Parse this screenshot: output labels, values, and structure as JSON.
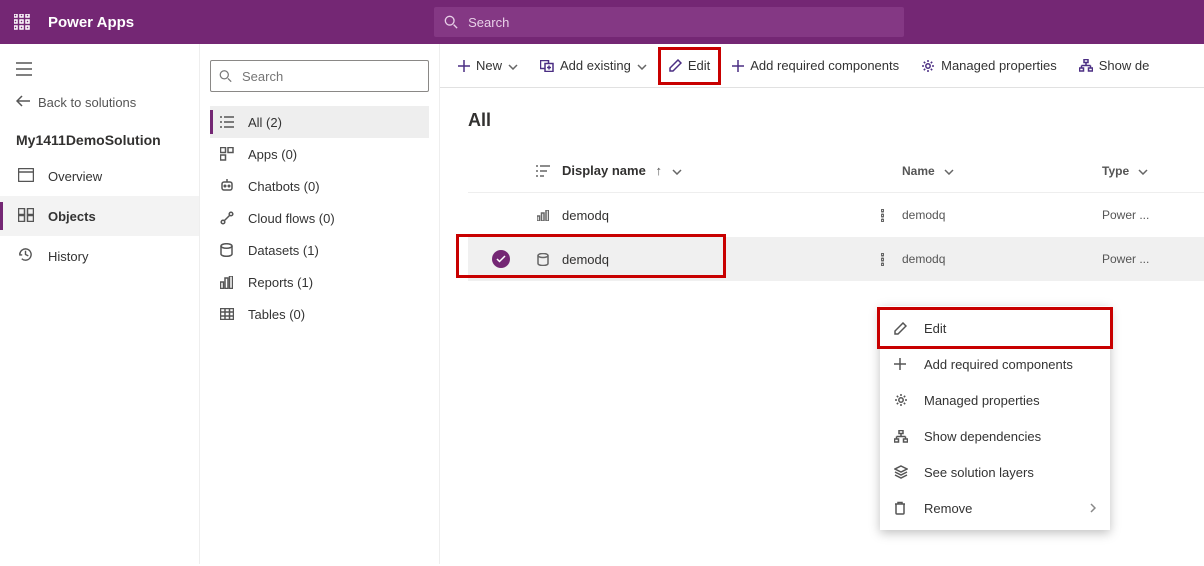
{
  "app": {
    "title": "Power Apps",
    "searchPlaceholder": "Search"
  },
  "leftNav": {
    "back": "Back to solutions",
    "solutionName": "My1411DemoSolution",
    "items": [
      {
        "label": "Overview"
      },
      {
        "label": "Objects"
      },
      {
        "label": "History"
      }
    ]
  },
  "midPanel": {
    "searchPlaceholder": "Search",
    "items": [
      {
        "label": "All  (2)"
      },
      {
        "label": "Apps  (0)"
      },
      {
        "label": "Chatbots  (0)"
      },
      {
        "label": "Cloud flows  (0)"
      },
      {
        "label": "Datasets  (1)"
      },
      {
        "label": "Reports  (1)"
      },
      {
        "label": "Tables  (0)"
      }
    ]
  },
  "toolbar": {
    "new": "New",
    "addExisting": "Add existing",
    "edit": "Edit",
    "addRequired": "Add required components",
    "managedProps": "Managed properties",
    "showDeps": "Show de"
  },
  "content": {
    "title": "All",
    "headers": {
      "display": "Display name",
      "name": "Name",
      "type": "Type"
    },
    "rows": [
      {
        "display": "demodq",
        "name": "demodq",
        "type": "Power ..."
      },
      {
        "display": "demodq",
        "name": "demodq",
        "type": "Power ..."
      }
    ]
  },
  "contextMenu": {
    "edit": "Edit",
    "addRequired": "Add required components",
    "managedProps": "Managed properties",
    "showDeps": "Show dependencies",
    "seeLayers": "See solution layers",
    "remove": "Remove"
  }
}
